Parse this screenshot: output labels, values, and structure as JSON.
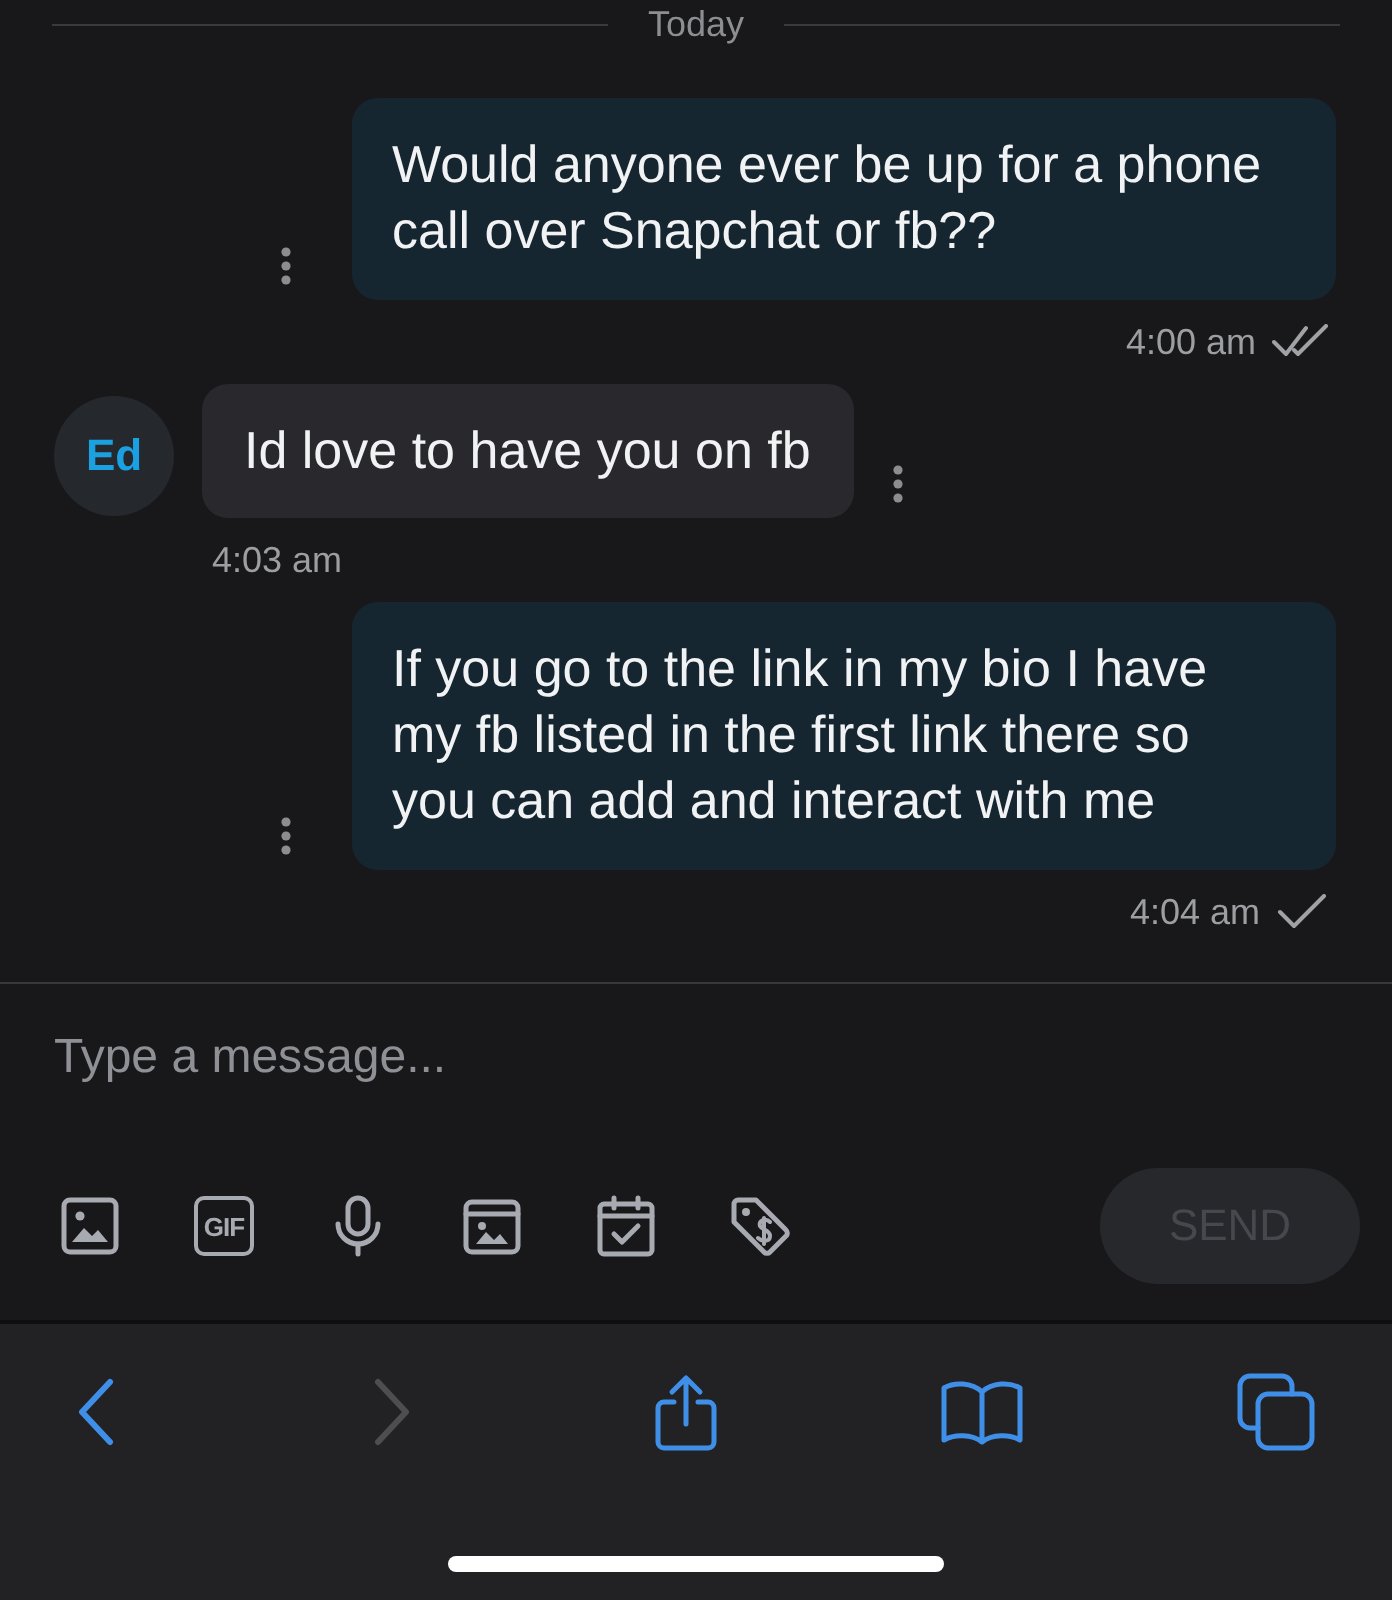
{
  "date_divider": {
    "label": "Today"
  },
  "messages": [
    {
      "kind": "outgoing",
      "text": "Would anyone ever be up for a phone call over Snapchat or fb??",
      "time": "4:00 am",
      "read": true
    },
    {
      "kind": "incoming",
      "sender_initials": "Ed",
      "text": "Id love to have you on fb",
      "time": "4:03 am"
    },
    {
      "kind": "outgoing",
      "text": "If you go to the link in my bio I have my fb listed in the first link there so you can add and interact with me",
      "time": "4:04 am",
      "read": false
    }
  ],
  "composer": {
    "placeholder": "Type a message...",
    "attachments": [
      {
        "kind": "image"
      },
      {
        "kind": "gif",
        "label": "GIF"
      },
      {
        "kind": "microphone"
      },
      {
        "kind": "album"
      },
      {
        "kind": "calendar"
      },
      {
        "kind": "price_tag"
      }
    ],
    "send_button": {
      "label": "SEND",
      "disabled": true
    }
  },
  "browser_toolbar": {
    "items": [
      {
        "kind": "back",
        "disabled": false
      },
      {
        "kind": "forward",
        "disabled": true
      },
      {
        "kind": "share",
        "disabled": false
      },
      {
        "kind": "bookmarks",
        "disabled": false
      },
      {
        "kind": "tabs",
        "disabled": false
      }
    ]
  }
}
